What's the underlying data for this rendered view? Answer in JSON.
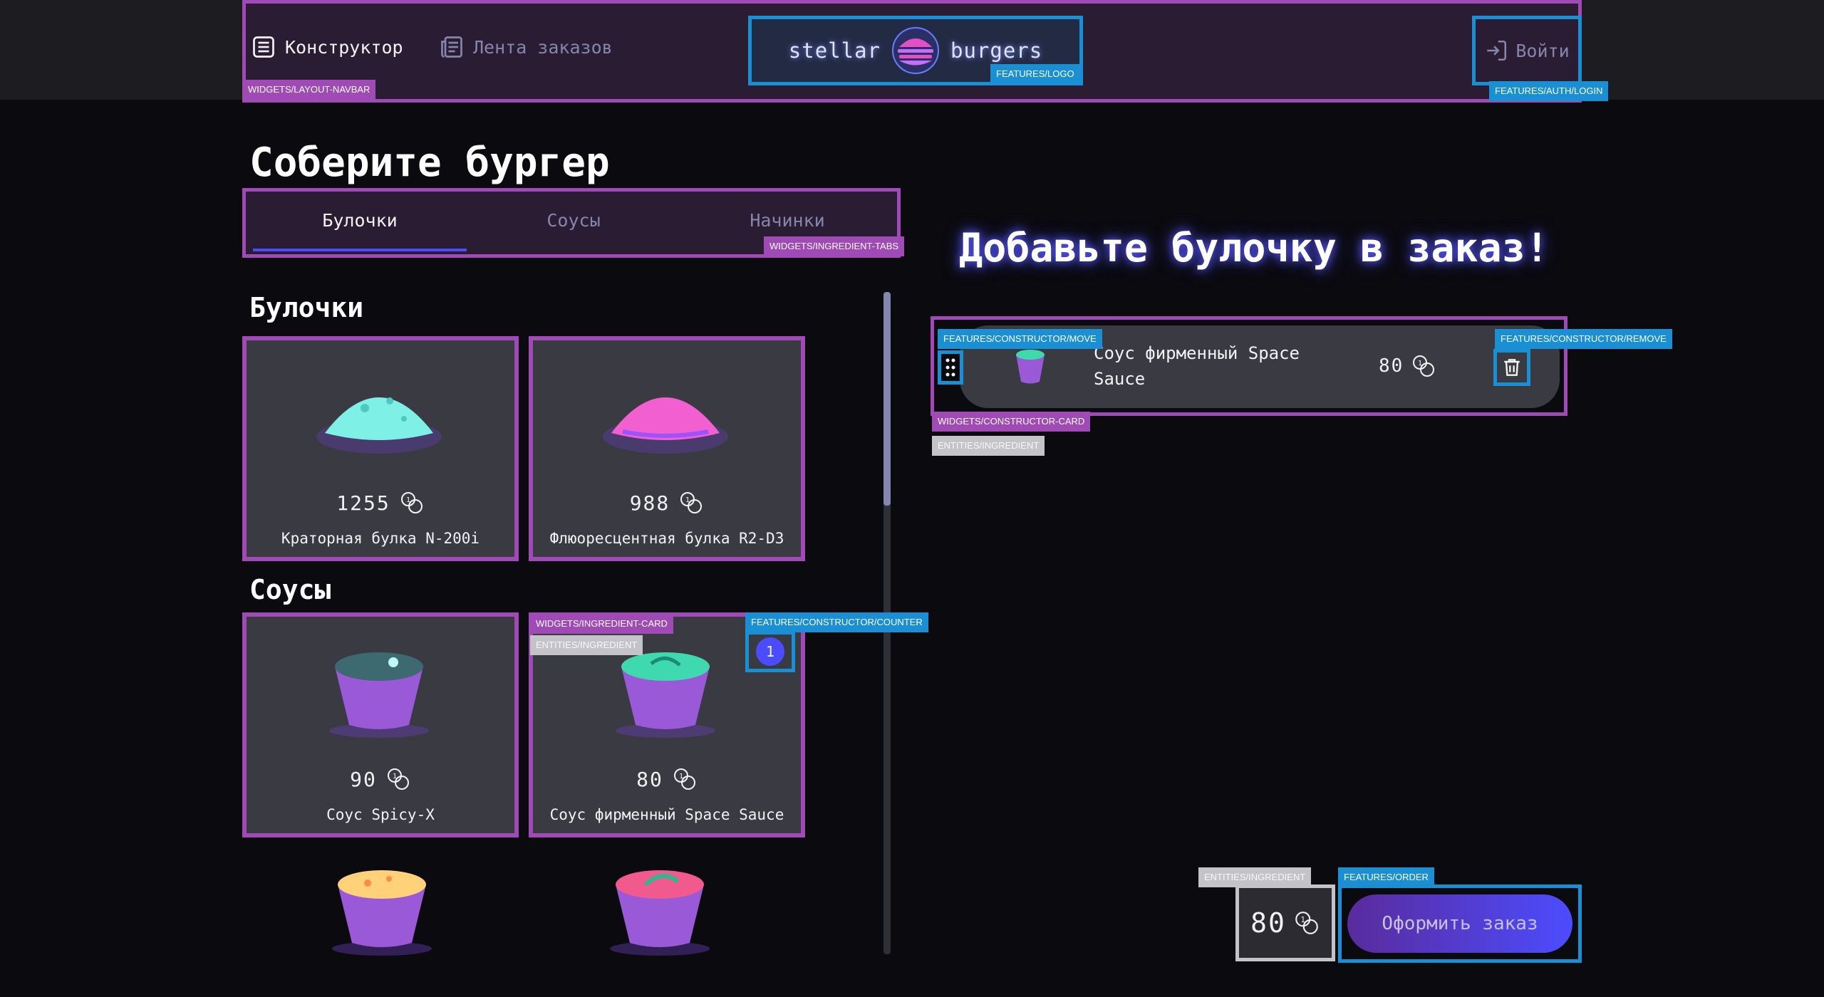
{
  "header": {
    "constructor_label": "Конструктор",
    "feed_label": "Лента заказов",
    "logo_left": "stellar",
    "logo_right": "burgers",
    "login_label": "Войти"
  },
  "title": "Соберите бургер",
  "tabs": [
    {
      "label": "Булочки",
      "active": true
    },
    {
      "label": "Соусы",
      "active": false
    },
    {
      "label": "Начинки",
      "active": false
    }
  ],
  "sections": {
    "buns_title": "Булочки",
    "sauces_title": "Соусы"
  },
  "ingredients": [
    {
      "name": "Краторная булка N-200i",
      "price": "1255",
      "kind": "bun",
      "color": "#7ef0e6"
    },
    {
      "name": "Флюоресцентная булка R2-D3",
      "price": "988",
      "kind": "bun",
      "color": "#f25fd0"
    },
    {
      "name": "Соус Spicy-X",
      "price": "90",
      "kind": "sauce",
      "color": "#3c6a70"
    },
    {
      "name": "Соус фирменный Space Sauce",
      "price": "80",
      "kind": "sauce",
      "color": "#3fd9b0"
    },
    {
      "name": "",
      "price": "",
      "kind": "sauce",
      "color": "#ffd27a"
    },
    {
      "name": "",
      "price": "",
      "kind": "sauce",
      "color": "#f05a8c"
    }
  ],
  "counter_value": "1",
  "constructor": {
    "hint": "Добавьте булочку в заказ!",
    "item_name": "Соус фирменный Space Sauce",
    "item_price": "80",
    "total": "80",
    "order_button": "Оформить заказ"
  },
  "debug_tags": {
    "navbar": "WIDGETS/LAYOUT-NAVBAR",
    "logo": "FEATURES/LOGO",
    "login": "FEATURES/AUTH/LOGIN",
    "tabs": "WIDGETS/INGREDIENT-TABS",
    "ingredient_card": "WIDGETS/INGREDIENT-CARD",
    "entities_ingredient": "ENTITIES/INGREDIENT",
    "counter": "FEATURES/CONSTRUCTOR/COUNTER",
    "move": "FEATURES/CONSTRUCTOR/MOVE",
    "remove": "FEATURES/CONSTRUCTOR/REMOVE",
    "constructor_card": "WIDGETS/CONSTRUCTOR-CARD",
    "order": "FEATURES/ORDER"
  },
  "colors": {
    "accent": "#4c4cff",
    "widget_outline": "#a04bb5",
    "feature_outline": "#1b8fd3",
    "entity_outline": "#c4c4c8",
    "inactive_text": "#8585ad"
  }
}
